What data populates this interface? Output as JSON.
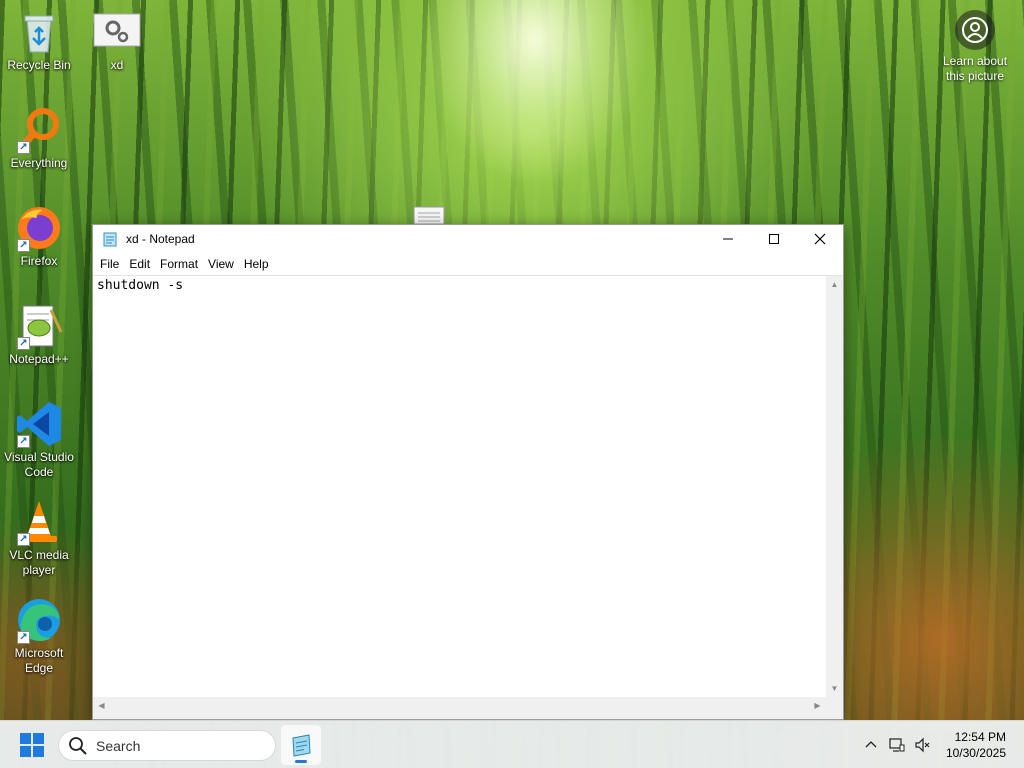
{
  "desktop": {
    "icons": [
      {
        "label": "Recycle Bin"
      },
      {
        "label": "xd"
      },
      {
        "label": "Everything"
      },
      {
        "label": "Firefox"
      },
      {
        "label": "Notepad++"
      },
      {
        "label": "Visual Studio Code"
      },
      {
        "label": "VLC media player"
      },
      {
        "label": "Microsoft Edge"
      }
    ],
    "learn_picture": "Learn about this picture"
  },
  "notepad": {
    "title": "xd - Notepad",
    "menu": [
      "File",
      "Edit",
      "Format",
      "View",
      "Help"
    ],
    "content": "shutdown -s"
  },
  "taskbar": {
    "search_placeholder": "Search",
    "clock_time": "12:54 PM",
    "clock_date": "10/30/2025",
    "accent": "#1f7ae0"
  }
}
